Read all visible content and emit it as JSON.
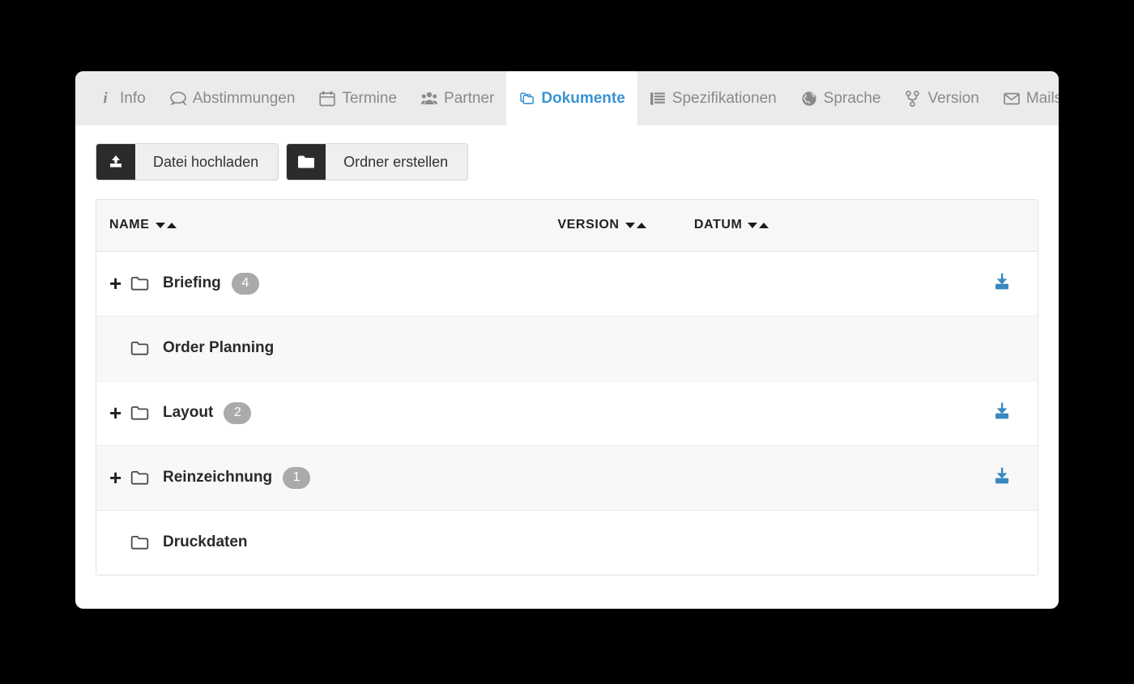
{
  "tabs": [
    {
      "id": "info",
      "label": "Info",
      "icon": "info-icon",
      "active": false
    },
    {
      "id": "abstimmungen",
      "label": "Abstimmungen",
      "icon": "comment-icon",
      "active": false
    },
    {
      "id": "termine",
      "label": "Termine",
      "icon": "calendar-icon",
      "active": false
    },
    {
      "id": "partner",
      "label": "Partner",
      "icon": "users-icon",
      "active": false
    },
    {
      "id": "dokumente",
      "label": "Dokumente",
      "icon": "documents-icon",
      "active": true
    },
    {
      "id": "spezifikationen",
      "label": "Spezifikationen",
      "icon": "list-icon",
      "active": false
    },
    {
      "id": "sprache",
      "label": "Sprache",
      "icon": "globe-icon",
      "active": false
    },
    {
      "id": "version",
      "label": "Version",
      "icon": "code-branch-icon",
      "active": false
    },
    {
      "id": "mails",
      "label": "Mails",
      "icon": "envelope-icon",
      "active": false
    }
  ],
  "toolbar": {
    "upload_label": "Datei hochladen",
    "upload_icon": "upload-icon",
    "create_folder_label": "Ordner erstellen",
    "create_folder_icon": "folder-filled-icon"
  },
  "table": {
    "columns": [
      {
        "key": "name",
        "label": "NAME",
        "sortable": true
      },
      {
        "key": "version",
        "label": "VERSION",
        "sortable": true
      },
      {
        "key": "datum",
        "label": "DATUM",
        "sortable": true
      },
      {
        "key": "actions",
        "label": "",
        "sortable": false
      }
    ],
    "rows": [
      {
        "name": "Briefing",
        "badge": "4",
        "expandable": true,
        "download": true,
        "version": "",
        "datum": "",
        "stripe": "odd"
      },
      {
        "name": "Order Planning",
        "badge": null,
        "expandable": false,
        "download": false,
        "version": "",
        "datum": "",
        "stripe": "even"
      },
      {
        "name": "Layout",
        "badge": "2",
        "expandable": true,
        "download": true,
        "version": "",
        "datum": "",
        "stripe": "odd"
      },
      {
        "name": "Reinzeichnung",
        "badge": "1",
        "expandable": true,
        "download": true,
        "version": "",
        "datum": "",
        "stripe": "even"
      },
      {
        "name": "Druckdaten",
        "badge": null,
        "expandable": false,
        "download": false,
        "version": "",
        "datum": "",
        "stripe": "odd"
      }
    ],
    "expander_glyph": "+",
    "folder_icon": "folder-outline-icon",
    "download_icon": "download-icon"
  },
  "colors": {
    "page_background": "#000000",
    "card_background": "#ffffff",
    "tabbar_background": "#ebebeb",
    "active_tab_text": "#3a93d4",
    "inactive_tab_text": "#8a8a8a",
    "button_icon_background": "#2b2b2b",
    "badge_background": "#aaaaaa",
    "download_icon": "#3889bd",
    "row_stripe": "#f8f8f8"
  }
}
